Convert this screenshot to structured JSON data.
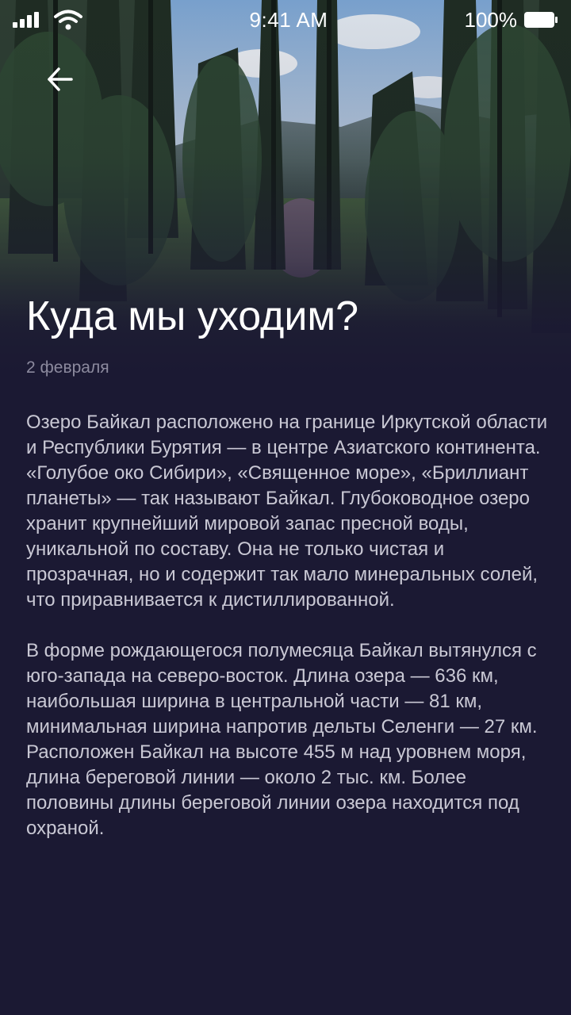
{
  "status_bar": {
    "time": "9:41 AM",
    "battery_percent": "100%",
    "signal_icon": "cellular-signal-icon",
    "wifi_icon": "wifi-icon",
    "battery_icon": "battery-full-icon"
  },
  "navigation": {
    "back_icon": "arrow-left-icon"
  },
  "hero": {
    "image": "forest-photo"
  },
  "article": {
    "title": "Куда мы уходим?",
    "date": "2 февраля",
    "paragraphs": [
      "Озеро Байкал расположено на границе Иркутской области и Республики Бурятия — в центре Азиатского континента. «Голубое око Сибири», «Священное море», «Бриллиант планеты» — так называют Байкал. Глубоководное озеро хранит крупнейший мировой запас пресной воды, уникальной по составу. Она не только чистая и прозрачная, но и содержит так мало минеральных солей, что приравнивается к дистиллированной.",
      "В форме рождающегося полумесяца Байкал вытянулся с юго-запада на северо-восток. Длина озера — 636 км, наибольшая ширина в центральной части — 81 км, минимальная ширина напротив дельты Селенги — 27 км. Расположен Байкал на высоте 455 м над уровнем моря, длина береговой линии — около 2 тыс. км. Более половины длины береговой линии озера находится под охраной."
    ]
  },
  "colors": {
    "background": "#1b1933",
    "title": "#ffffff",
    "date": "#8c8a9e",
    "body_text": "#c9c8d4"
  }
}
